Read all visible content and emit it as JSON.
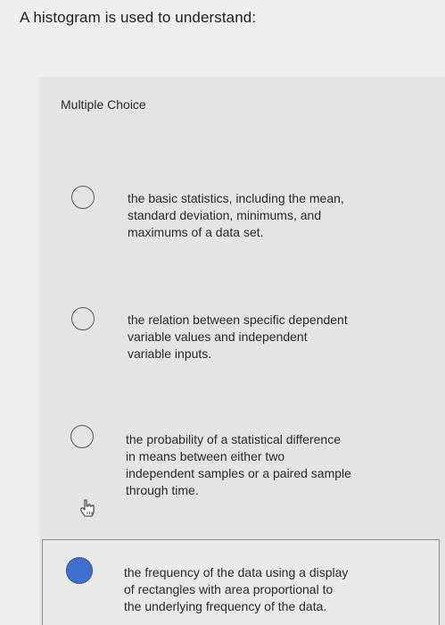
{
  "question": {
    "text": "A histogram is used to understand:"
  },
  "panel": {
    "type_label": "Multiple Choice"
  },
  "options": [
    {
      "text_lines": [
        "the basic statistics, including the mean,",
        "standard deviation, minimums, and",
        "maximums of a data set."
      ],
      "selected": false
    },
    {
      "text_lines": [
        "the relation between specific dependent",
        "variable values and independent",
        "variable inputs."
      ],
      "selected": false
    },
    {
      "text_lines": [
        "the probability of a statistical difference",
        "in means between either two",
        "independent samples or a paired sample",
        "through time."
      ],
      "selected": false
    },
    {
      "text_lines": [
        "the frequency of the data using a display",
        "of rectangles with area proportional to",
        "the underlying frequency of the data."
      ],
      "selected": true
    }
  ],
  "colors": {
    "selected_radio": "#3f6fcf",
    "background": "#eeeeec"
  },
  "icons": {
    "cursor": "hand-pointer-icon"
  }
}
